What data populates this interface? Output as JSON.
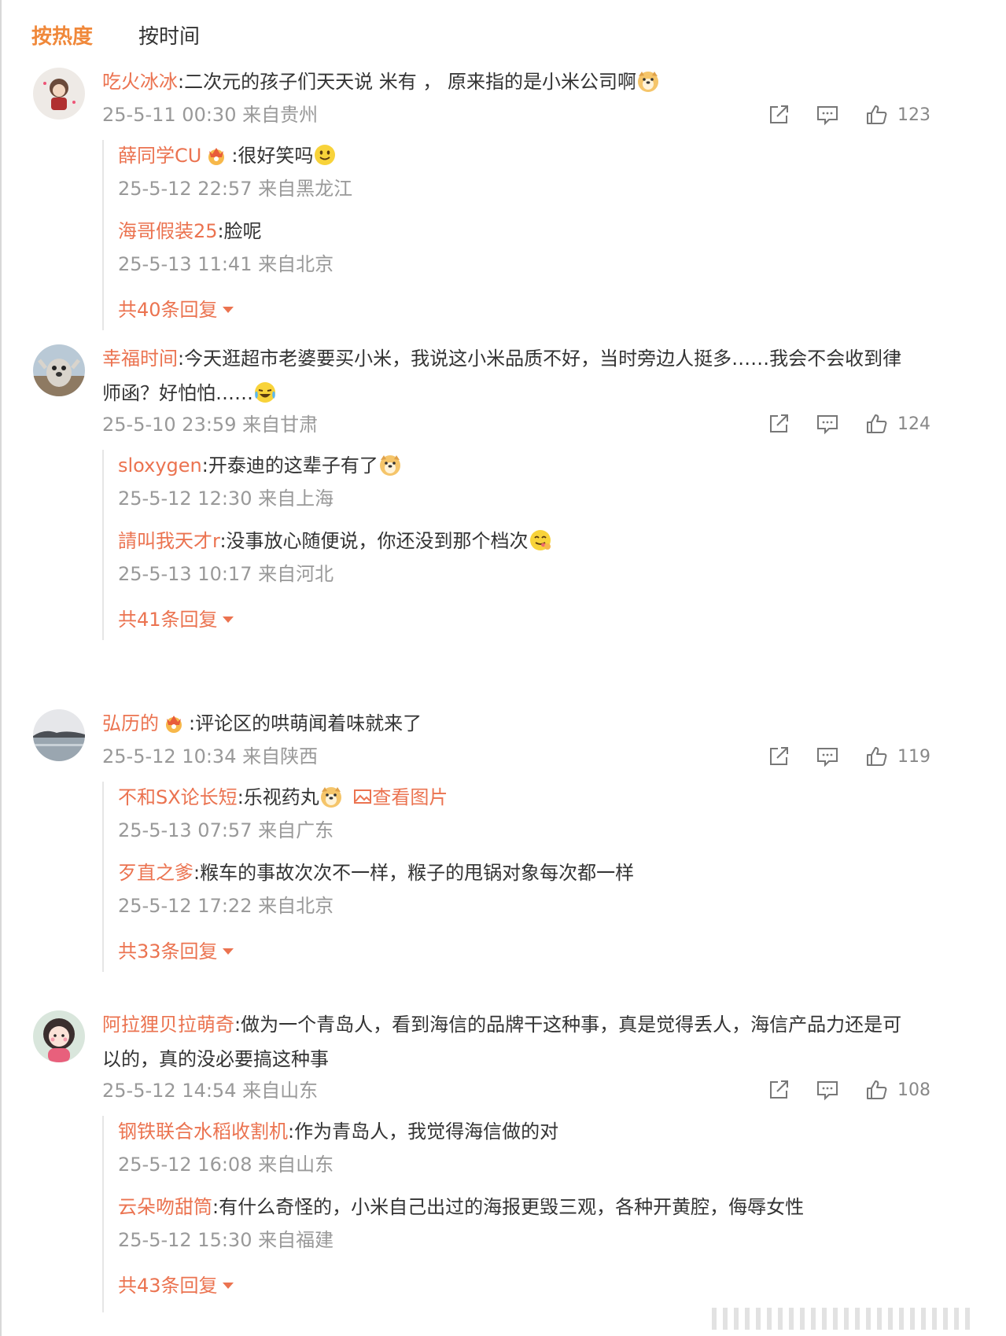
{
  "sort_tabs": {
    "hot": "按热度",
    "time": "按时间"
  },
  "comments": [
    {
      "user": "吃火冰冰",
      "text": ":二次元的孩子们天天说 米有 ， 原来指的是小米公司啊",
      "emoji": "dog-face-emoji",
      "meta": "25-5-11 00:30 来自贵州",
      "likes": "123",
      "replies": [
        {
          "user": "薛同学CU",
          "badge": "crown-badge",
          "text": ":很好笑吗",
          "emoji": "smile-emoji",
          "meta": "25-5-12 22:57 来自黑龙江"
        },
        {
          "user": "海哥假装25",
          "text": ":脸呢",
          "meta": "25-5-13 11:41 来自北京"
        }
      ],
      "more": "共40条回复"
    },
    {
      "user": "幸福时间",
      "text_line1": ":今天逛超市老婆要买小米，我说这小米品质不好，当时旁边人挺多……我会不会收到律",
      "text_line2": "师函？好怕怕……",
      "emoji": "crying-laugh-emoji",
      "meta": "25-5-10 23:59 来自甘肃",
      "likes": "124",
      "replies": [
        {
          "user": "sloxygen",
          "text": ":开泰迪的这辈子有了",
          "emoji": "dog-face-emoji",
          "meta": "25-5-12 12:30 来自上海"
        },
        {
          "user": "請叫我天才r",
          "text": ":没事放心随便说，你还没到那个档次",
          "emoji": "yum-emoji",
          "meta": "25-5-13 10:17 来自河北"
        }
      ],
      "more": "共41条回复"
    },
    {
      "user": "弘历的",
      "badge": "crown-badge",
      "text": ":评论区的哄萌闻着味就来了",
      "meta": "25-5-12 10:34 来自陕西",
      "likes": "119",
      "replies": [
        {
          "user": "不和SX论长短",
          "text": ":乐视药丸",
          "emoji": "dog-face-emoji",
          "link": "查看图片",
          "meta": "25-5-13 07:57 来自广东"
        },
        {
          "user": "歹直之爹",
          "text": ":糇车的事故次次不一样，糇子的甩锅对象每次都一样",
          "meta": "25-5-12 17:22 来自北京"
        }
      ],
      "more": "共33条回复"
    },
    {
      "user": "阿拉狸贝拉萌奇",
      "text_line1": ":做为一个青岛人，看到海信的品牌干这种事，真是觉得丢人，海信产品力还是可",
      "text_line2": "以的，真的没必要搞这种事",
      "meta": "25-5-12 14:54 来自山东",
      "likes": "108",
      "replies": [
        {
          "user": "钢铁联合水稻收割机",
          "text": ":作为青岛人，我觉得海信做的对",
          "meta": "25-5-12 16:08 来自山东"
        },
        {
          "user": "云朵吻甜筒",
          "text": ":有什么奇怪的，小米自己出过的海报更毁三观，各种开黄腔，侮辱女性",
          "meta": "25-5-12 15:30 来自福建"
        }
      ],
      "more": "共43条回复"
    }
  ],
  "colors": {
    "accent": "#f0883a",
    "username": "#eb7350",
    "meta": "#999999",
    "text": "#333333"
  },
  "icons": [
    "share-icon",
    "comment-icon",
    "like-icon",
    "triangle-down-icon",
    "image-icon"
  ]
}
